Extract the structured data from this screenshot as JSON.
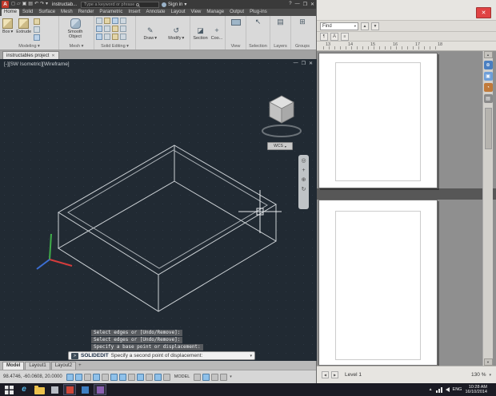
{
  "icons": {
    "close": "✕",
    "minimize": "—",
    "maximize": "❐",
    "dropdown": "▾",
    "up": "▲",
    "down": "▼",
    "left": "◀",
    "right": "▶",
    "undo": "↶",
    "redo": "↷",
    "open": "▱",
    "save": "▣",
    "print": "▤",
    "new": "◻",
    "help": "?",
    "orbit": "◎",
    "zoom_in": "⊕",
    "refresh": "↻",
    "plus": "+",
    "pencil": "✎",
    "select": "↖",
    "layers": "▤",
    "groups": "⊞",
    "modify": "↺",
    "section": "◪",
    "para": "¶",
    "list": "≡",
    "prompt": ">",
    "pin": "▣",
    "pie": "◔",
    "grid": "▤"
  },
  "colors": {
    "viewport_bg": "#212a33",
    "ribbon_bg": "#d9d9d9",
    "titlebar_bg": "#3a3a3a",
    "taskbar_bg": "#1b1b24",
    "doc_gray": "#8f8f8f",
    "close_red": "#e04343",
    "wire": "#cdd2d6",
    "ucs_x": "#d43c3c",
    "ucs_y": "#3fae4a",
    "ucs_z": "#3c6fd4"
  },
  "autocad": {
    "titlebar": {
      "logo": "A",
      "title": "instructab...",
      "search_placeholder": "Type a keyword or phrase",
      "signin": "Sign in"
    },
    "ribbon_tabs": [
      "Home",
      "Solid",
      "Surface",
      "Mesh",
      "Render",
      "Parametric",
      "Insert",
      "Annotate",
      "Layout",
      "View",
      "Manage",
      "Output",
      "Plug-ins"
    ],
    "panels": {
      "box": "Box",
      "extrude": "Extrude",
      "modeling": "Modeling",
      "smooth_object": "Smooth Object",
      "mesh": "Mesh",
      "solid_editing": "Solid Editing",
      "draw": "Draw",
      "modify": "Modify",
      "section": "Section",
      "coordinates": "Coo...",
      "view": "View",
      "selection": "Selection",
      "layers": "Layers",
      "groups": "Groups"
    },
    "file_tab": "instructables project",
    "viewport": {
      "label": "[-][SW Isometric][Wireframe]",
      "wcs": "WCS"
    },
    "command": {
      "history": [
        "Select edges or [Undo/Remove]:",
        "Select edges or [Undo/Remove]:",
        "Specify a base point or displacement:"
      ],
      "name": "SOLIDEDIT",
      "prompt": "Specify a second point of displacement:"
    },
    "layout_tabs": [
      "Model",
      "Layout1",
      "Layout2"
    ],
    "layout_add": "+",
    "status": {
      "coords": "98.4746, -60.0608, 20.0000",
      "model_label": "MODEL"
    }
  },
  "docapp": {
    "toolbar": {
      "combo": "Find"
    },
    "ruler": [
      "13",
      "14",
      "15",
      "16",
      "17",
      "18"
    ],
    "status": {
      "left": "Level 1",
      "zoom": "130 %"
    }
  },
  "taskbar": {
    "lang": "ENG",
    "time": "10:28 AM",
    "date": "16/10/2014"
  }
}
